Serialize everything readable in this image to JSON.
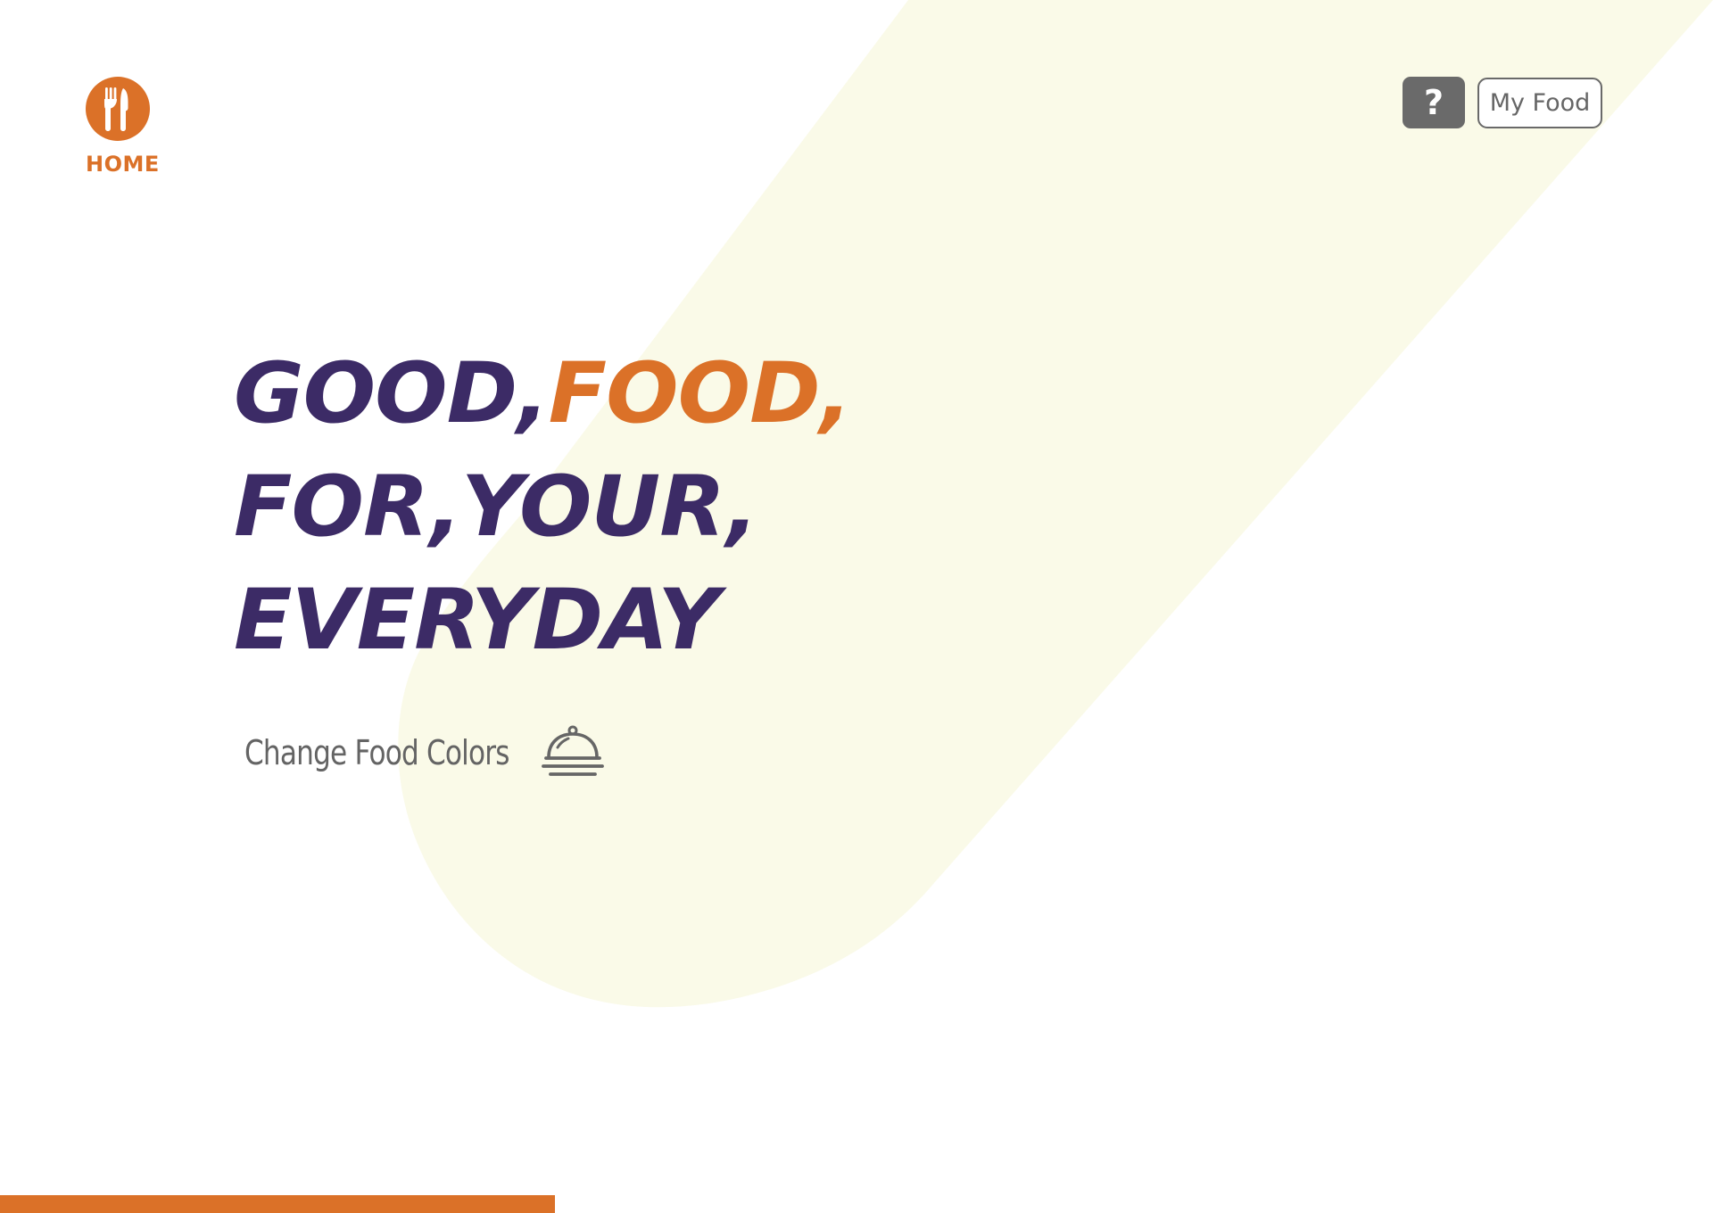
{
  "navigation": {
    "home_label": "HOME",
    "home_icon": "fork-knife-icon"
  },
  "top_actions": {
    "help_label": "?",
    "my_food_label": "My Food"
  },
  "hero": {
    "line_one_primary": "GOOD,",
    "line_one_accent": "FOOD,",
    "line_two": "FOR,YOUR,",
    "line_three": "EVERYDAY"
  },
  "change_colors": {
    "label": "Change Food Colors",
    "icon": "cloche-icon"
  },
  "colors": {
    "accent": "#db7128",
    "primary_text": "#3c2b66",
    "secondary_text": "#646464",
    "background_shape": "#fafae8"
  }
}
